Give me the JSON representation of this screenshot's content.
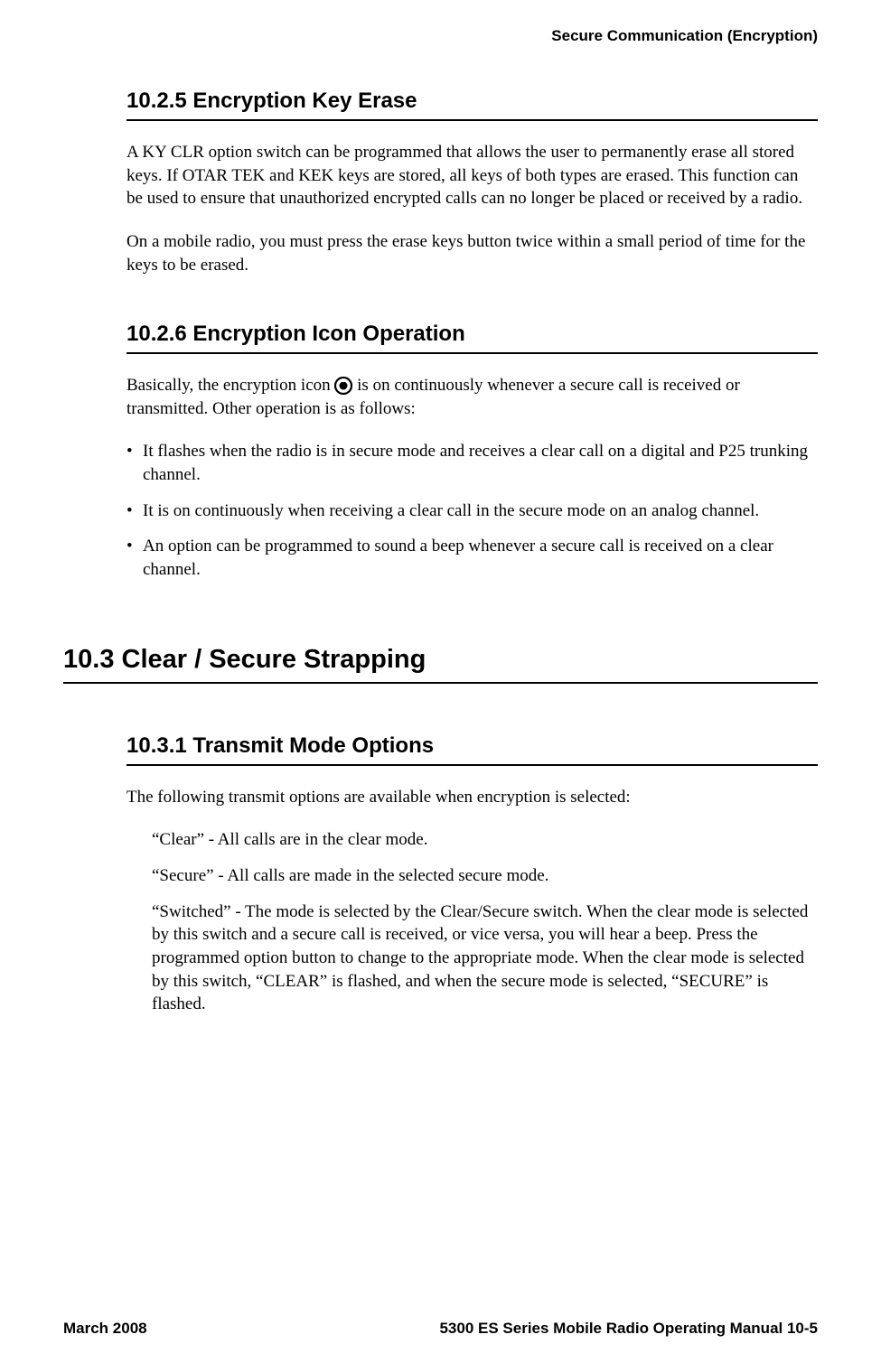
{
  "header": {
    "title": "Secure Communication (Encryption)"
  },
  "sections": {
    "s1": {
      "heading": "10.2.5   Encryption Key Erase",
      "p1": "A KY CLR option switch can be programmed that allows the user to permanently erase all stored keys. If OTAR TEK and KEK keys are stored, all keys of both types are erased. This function can be used to ensure that unauthorized encrypted calls can no longer be placed or received by a radio.",
      "p2": "On a mobile radio, you must press the erase keys button twice within a small period of time for the keys to be erased."
    },
    "s2": {
      "heading": "10.2.6   Encryption Icon Operation",
      "p1a": "Basically, the encryption icon ",
      "p1b": " is on continuously whenever a secure call is received or transmitted. Other operation is as follows:",
      "bullets": [
        "It flashes when the radio is in secure mode and receives a clear call on a digital and P25 trunking channel.",
        "It is on continuously when receiving a clear call in the secure mode on an analog channel.",
        "An option can be programmed to sound a beep whenever a secure call is received on a clear channel."
      ]
    },
    "s3": {
      "heading": "10.3    Clear / Secure Strapping"
    },
    "s4": {
      "heading": "10.3.1   Transmit Mode Options",
      "p1": "The following transmit options are available when encryption is selected:",
      "opts": [
        "“Clear” - All calls are in the clear mode.",
        "“Secure” - All calls are made in the selected secure mode.",
        "“Switched” - The mode is selected by the Clear/Secure switch. When the clear mode is selected by this switch and a secure call is received, or vice versa, you will hear a beep. Press the programmed option button to change to the appropriate mode. When the clear mode is selected by this switch, “CLEAR” is flashed, and when the secure mode is selected, “SECURE” is flashed."
      ]
    }
  },
  "footer": {
    "left": "March 2008",
    "right": "5300 ES Series Mobile Radio Operating Manual     10-5"
  }
}
